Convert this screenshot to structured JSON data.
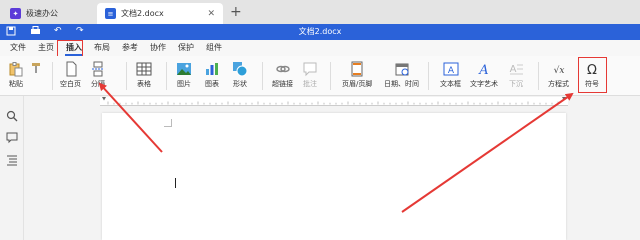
{
  "browser_tabs": [
    {
      "label": "极速办公"
    },
    {
      "label": "文档2.docx"
    }
  ],
  "title_bar": {
    "title": "文档2.docx"
  },
  "menu": {
    "items": [
      {
        "label": "文件"
      },
      {
        "label": "主页"
      },
      {
        "label": "插入"
      },
      {
        "label": "布局"
      },
      {
        "label": "参考"
      },
      {
        "label": "协作"
      },
      {
        "label": "保护"
      },
      {
        "label": "组件"
      }
    ],
    "active": "插入"
  },
  "ribbon": {
    "paste": "粘贴",
    "blank_page": "空白页",
    "break": "分隔",
    "table": "表格",
    "image": "图片",
    "chart": "图表",
    "shape": "形状",
    "hyperlink": "超链接",
    "comment": "批注",
    "header_footer": "页眉/页脚",
    "date_time": "日期、时间",
    "textbox": "文本框",
    "word_art": "文字艺术",
    "dropcap": "下沉",
    "equation": "方程式",
    "symbol": "符号"
  },
  "colors": {
    "accent": "#2b62d9",
    "highlight": "#e53935"
  }
}
